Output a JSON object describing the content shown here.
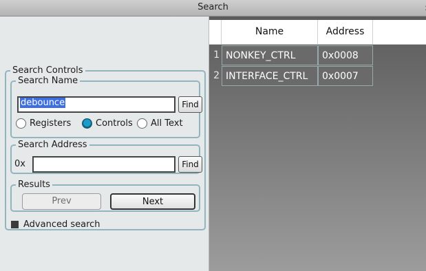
{
  "window": {
    "title": "Search",
    "edge_glyph": ":"
  },
  "search_controls": {
    "legend": "Search Controls",
    "search_name": {
      "legend": "Search Name",
      "value": "debounce",
      "find_label": "Find",
      "radios": [
        {
          "label": "Registers",
          "selected": false
        },
        {
          "label": "Controls",
          "selected": true
        },
        {
          "label": "All Text",
          "selected": false
        }
      ]
    },
    "search_address": {
      "legend": "Search Address",
      "prefix": "0x",
      "value": "",
      "find_label": "Find"
    },
    "results": {
      "legend": "Results",
      "prev_label": "Prev",
      "next_label": "Next"
    },
    "advanced": {
      "label": "Advanced search",
      "checked": true
    }
  },
  "results_grid": {
    "columns": [
      "Name",
      "Address"
    ],
    "rows": [
      {
        "index": "1",
        "name": "NONKEY_CTRL",
        "address": "0x0008"
      },
      {
        "index": "2",
        "name": "INTERFACE_CTRL",
        "address": "0x0007"
      }
    ]
  }
}
